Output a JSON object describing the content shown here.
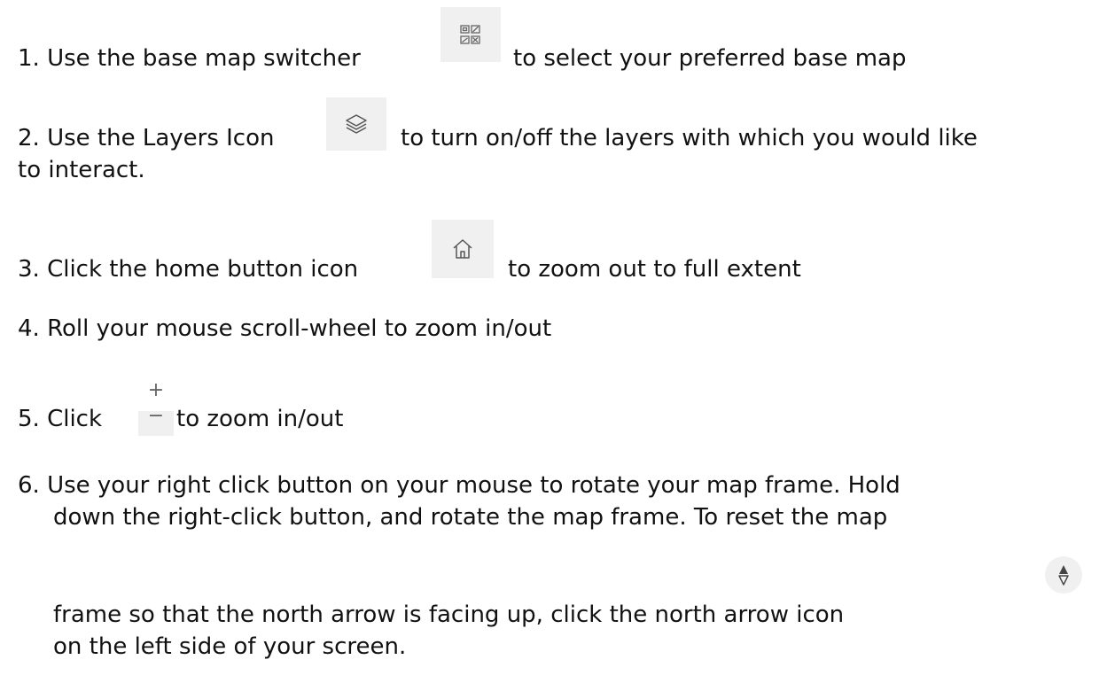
{
  "instructions": {
    "step1": {
      "before": "1. Use the base map switcher",
      "after": "to select your preferred base map",
      "icon": "basemap-switcher-icon"
    },
    "step2": {
      "before": "2. Use the Layers Icon",
      "after": "to turn on/off the layers with which you would like",
      "continued": "to interact.",
      "icon": "layers-icon"
    },
    "step3": {
      "before": "3. Click the home button icon",
      "after": "to zoom out to full extent",
      "icon": "home-icon"
    },
    "step4": {
      "text": "4. Roll your mouse scroll-wheel to zoom in/out"
    },
    "step5": {
      "before": "5. Click",
      "after": "to zoom in/out",
      "plus_glyph": "+",
      "minus_glyph": "−",
      "icon": "zoom-control-icon"
    },
    "step6": {
      "line1": "6. Use your right click button on your mouse to rotate your map frame. Hold",
      "line2": "down the right-click button, and rotate the map frame. To reset the map",
      "line3": "frame so that the north arrow is facing up, click the north arrow icon",
      "line4": "on the left side of your screen.",
      "icon": "north-arrow-icon"
    }
  }
}
